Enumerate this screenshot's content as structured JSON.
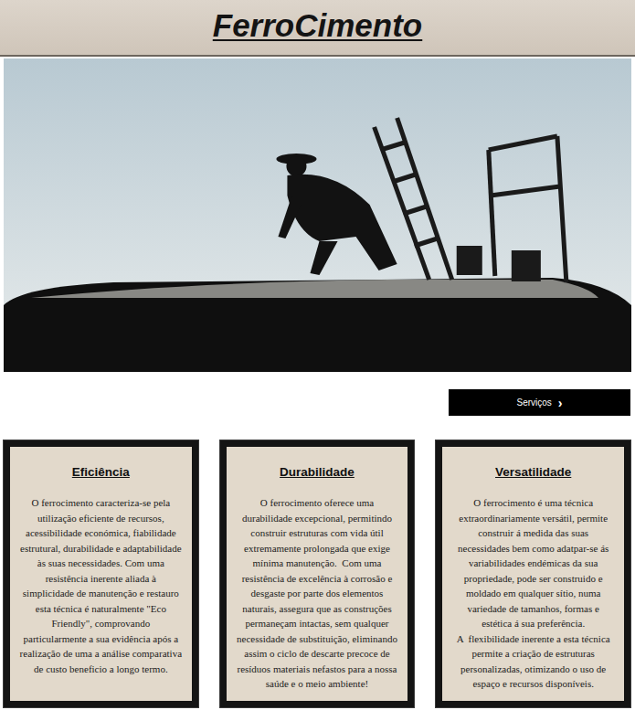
{
  "header": {
    "title": "FerroCimento"
  },
  "hero": {
    "kind": "photo"
  },
  "services_button": {
    "label": "Serviços",
    "icon": "›"
  },
  "cards": [
    {
      "title": "Eficiência",
      "paragraphs": [
        "O ferrocimento caracteriza-se pela utilização eficiente de recursos, acessibilidade económica, fiabilidade estrutural, durabilidade e adaptabilidade às suas necessidades. Com uma resistência inerente aliada à simplicidade de manutenção e restauro esta técnica é naturalmente \"Eco Friendly\", comprovando particularmente a sua evidência após a realização de uma a análise comparativa de custo beneficio a longo termo."
      ]
    },
    {
      "title": "Durabilidade",
      "paragraphs": [
        "O ferrocimento oferece uma durabilidade excepcional, permitindo construir estruturas com vida útil extremamente prolongada que exige mínima manutenção.  Com uma resistência de excelência à corrosão e desgaste por parte dos elementos naturais, assegura que as construções permaneçam intactas, sem qualquer necessidade de substituição, eliminando assim o ciclo de descarte precoce de resíduos materiais nefastos para a nossa saúde e o meio ambiente!"
      ]
    },
    {
      "title": "Versatilidade",
      "paragraphs": [
        "O ferrocimento é uma técnica extraordinariamente versátil, permite construir á medida das suas necessidades bem como adatpar-se ás variabilidades endémicas da sua propriedade, pode ser construido e moldado em qualquer sítio, numa variedade de tamanhos, formas e estética á sua preferência.",
        "A  flexibilidade inerente a esta técnica permite a criação de estruturas personalizadas, otimizando o uso de espaço e recursos disponíveis."
      ]
    }
  ]
}
